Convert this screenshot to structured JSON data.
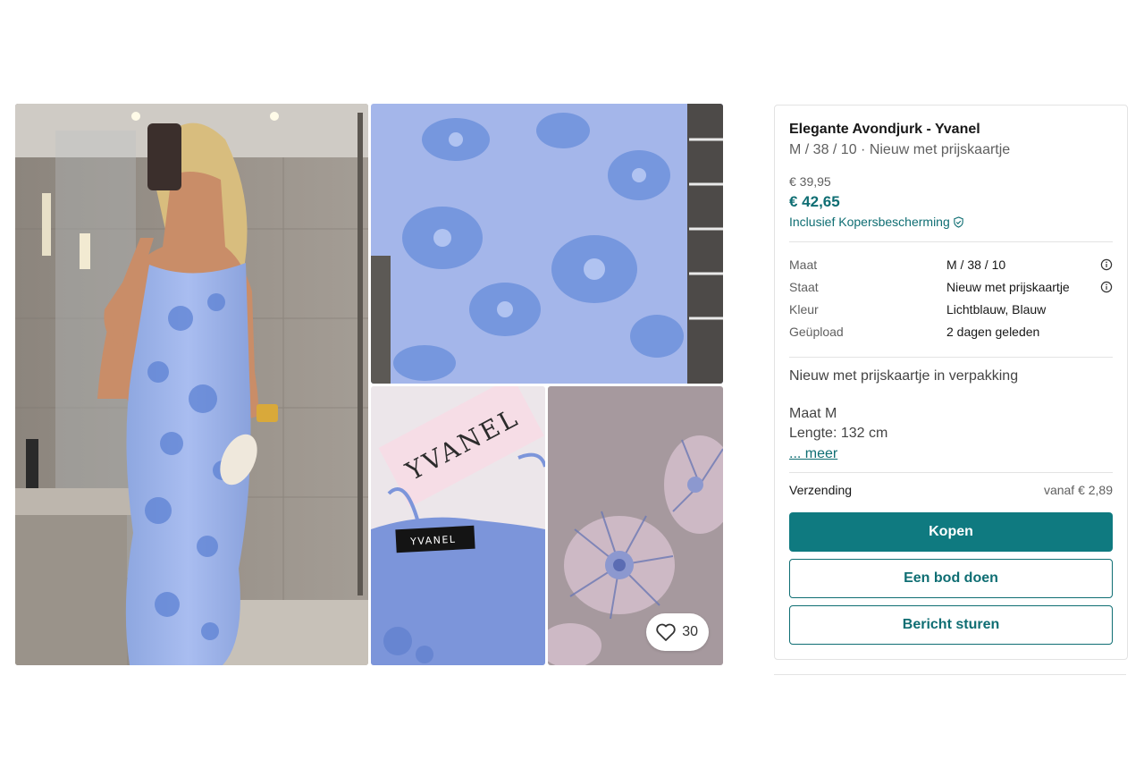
{
  "gallery": {
    "brand_tag_text": "YVANEL",
    "brand_label_text": "YVANEL",
    "favourites_count": "30"
  },
  "item": {
    "title": "Elegante Avondjurk - Yvanel",
    "subtitle": "M / 38 / 10 · Nieuw met prijskaartje",
    "price_original": "€ 39,95",
    "price_total": "€ 42,65",
    "buyer_protection": "Inclusief Kopersbescherming"
  },
  "details": [
    {
      "label": "Maat",
      "value": "M / 38 / 10",
      "info": true
    },
    {
      "label": "Staat",
      "value": "Nieuw met prijskaartje",
      "info": true
    },
    {
      "label": "Kleur",
      "value": "Lichtblauw, Blauw",
      "info": false
    },
    {
      "label": "Geüpload",
      "value": "2 dagen geleden",
      "info": false
    }
  ],
  "description": {
    "line1": "Nieuw met prijskaartje in verpakking",
    "line2": "Maat M",
    "line3": "Lengte: 132 cm",
    "more": "... meer"
  },
  "shipping": {
    "label": "Verzending",
    "value": "vanaf € 2,89"
  },
  "actions": {
    "buy": "Kopen",
    "offer": "Een bod doen",
    "message": "Bericht sturen"
  },
  "colors": {
    "accent": "#0f7a80",
    "accent_text": "#0f6e73",
    "dress_blue": "#9db4ea"
  },
  "icons": {
    "heart": "heart-icon",
    "shield": "shield-check-icon",
    "info": "info-icon"
  }
}
